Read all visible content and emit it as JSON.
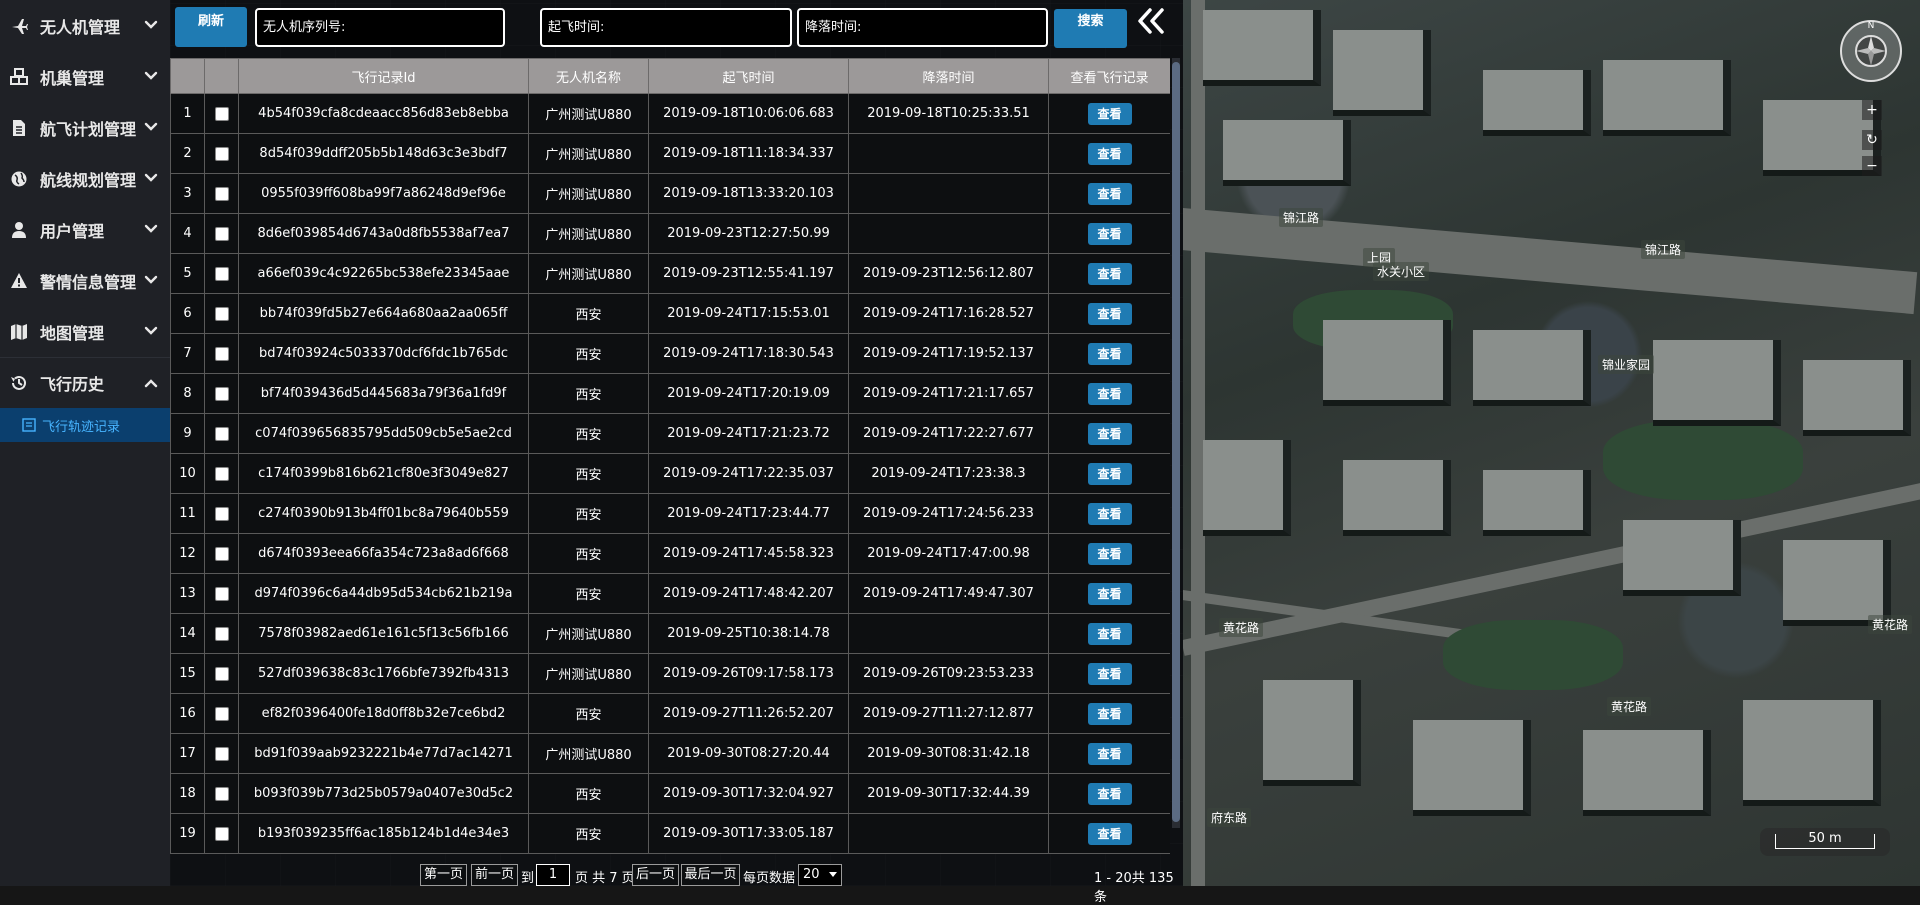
{
  "sidebar": {
    "items": [
      {
        "label": "无人机管理",
        "icon": "plane-icon",
        "open": false
      },
      {
        "label": "机巢管理",
        "icon": "cubes-icon",
        "open": false
      },
      {
        "label": "航飞计划管理",
        "icon": "file-icon",
        "open": false
      },
      {
        "label": "航线规划管理",
        "icon": "globe-icon",
        "open": false
      },
      {
        "label": "用户管理",
        "icon": "user-icon",
        "open": false
      },
      {
        "label": "警情信息管理",
        "icon": "warning-icon",
        "open": false
      },
      {
        "label": "地图管理",
        "icon": "map-icon",
        "open": false
      },
      {
        "label": "飞行历史",
        "icon": "history-icon",
        "open": true
      }
    ],
    "submenu": {
      "label": "飞行轨迹记录",
      "icon": "list-icon"
    }
  },
  "toolbar": {
    "refresh_label": "刷新",
    "serial_placeholder": "无人机序列号:",
    "takeoff_placeholder": "起飞时间:",
    "landing_placeholder": "降落时间:",
    "search_label": "搜索"
  },
  "table": {
    "columns": [
      "",
      "",
      "飞行记录Id",
      "无人机名称",
      "起飞时间",
      "降落时间",
      "查看飞行记录"
    ],
    "view_label": "查看",
    "rows": [
      {
        "num": "1",
        "id": "4b54f039cfa8cdeaacc856d83eb8ebba",
        "name": "广州测试U880",
        "takeoff": "2019-09-18T10:06:06.683",
        "landing": "2019-09-18T10:25:33.51"
      },
      {
        "num": "2",
        "id": "8d54f039ddff205b5b148d63c3e3bdf7",
        "name": "广州测试U880",
        "takeoff": "2019-09-18T11:18:34.337",
        "landing": ""
      },
      {
        "num": "3",
        "id": "0955f039ff608ba99f7a86248d9ef96e",
        "name": "广州测试U880",
        "takeoff": "2019-09-18T13:33:20.103",
        "landing": ""
      },
      {
        "num": "4",
        "id": "8d6ef039854d6743a0d8fb5538af7ea7",
        "name": "广州测试U880",
        "takeoff": "2019-09-23T12:27:50.99",
        "landing": ""
      },
      {
        "num": "5",
        "id": "a66ef039c4c92265bc538efe23345aae",
        "name": "广州测试U880",
        "takeoff": "2019-09-23T12:55:41.197",
        "landing": "2019-09-23T12:56:12.807"
      },
      {
        "num": "6",
        "id": "bb74f039fd5b27e664a680aa2aa065ff",
        "name": "西安",
        "takeoff": "2019-09-24T17:15:53.01",
        "landing": "2019-09-24T17:16:28.527"
      },
      {
        "num": "7",
        "id": "bd74f03924c5033370dcf6fdc1b765dc",
        "name": "西安",
        "takeoff": "2019-09-24T17:18:30.543",
        "landing": "2019-09-24T17:19:52.137"
      },
      {
        "num": "8",
        "id": "bf74f039436d5d445683a79f36a1fd9f",
        "name": "西安",
        "takeoff": "2019-09-24T17:20:19.09",
        "landing": "2019-09-24T17:21:17.657"
      },
      {
        "num": "9",
        "id": "c074f039656835795dd509cb5e5ae2cd",
        "name": "西安",
        "takeoff": "2019-09-24T17:21:23.72",
        "landing": "2019-09-24T17:22:27.677"
      },
      {
        "num": "10",
        "id": "c174f0399b816b621cf80e3f3049e827",
        "name": "西安",
        "takeoff": "2019-09-24T17:22:35.037",
        "landing": "2019-09-24T17:23:38.3"
      },
      {
        "num": "11",
        "id": "c274f0390b913b4ff01bc8a79640b559",
        "name": "西安",
        "takeoff": "2019-09-24T17:23:44.77",
        "landing": "2019-09-24T17:24:56.233"
      },
      {
        "num": "12",
        "id": "d674f0393eea66fa354c723a8ad6f668",
        "name": "西安",
        "takeoff": "2019-09-24T17:45:58.323",
        "landing": "2019-09-24T17:47:00.98"
      },
      {
        "num": "13",
        "id": "d974f0396c6a44db95d534cb621b219a",
        "name": "西安",
        "takeoff": "2019-09-24T17:48:42.207",
        "landing": "2019-09-24T17:49:47.307"
      },
      {
        "num": "14",
        "id": "7578f03982aed61e161c5f13c56fb166",
        "name": "广州测试U880",
        "takeoff": "2019-09-25T10:38:14.78",
        "landing": ""
      },
      {
        "num": "15",
        "id": "527df039638c83c1766bfe7392fb4313",
        "name": "广州测试U880",
        "takeoff": "2019-09-26T09:17:58.173",
        "landing": "2019-09-26T09:23:53.233"
      },
      {
        "num": "16",
        "id": "ef82f0396400fe18d0ff8b32e7ce6bd2",
        "name": "西安",
        "takeoff": "2019-09-27T11:26:52.207",
        "landing": "2019-09-27T11:27:12.877"
      },
      {
        "num": "17",
        "id": "bd91f039aab9232221b4e77d7ac14271",
        "name": "广州测试U880",
        "takeoff": "2019-09-30T08:27:20.44",
        "landing": "2019-09-30T08:31:42.18"
      },
      {
        "num": "18",
        "id": "b093f039b773d25b0579a0407e30d5c2",
        "name": "西安",
        "takeoff": "2019-09-30T17:32:04.927",
        "landing": "2019-09-30T17:32:44.39"
      },
      {
        "num": "19",
        "id": "b193f039235ff6ac185b124b1d4e34e3",
        "name": "西安",
        "takeoff": "2019-09-30T17:33:05.187",
        "landing": ""
      }
    ]
  },
  "pagination": {
    "first": "第一页",
    "prev": "前一页",
    "to": "到",
    "page": "1",
    "total_pages": "页 共 7 页",
    "next": "后一页",
    "last": "最后一页",
    "per_page_label": "每页数据",
    "page_size": "20",
    "range": "1 - 20共 135 条"
  },
  "map": {
    "labels": [
      "锦江路",
      "锦江路",
      "上园",
      "水关小区",
      "锦业家园",
      "黄花路",
      "黄花路",
      "黄花路",
      "府东路"
    ],
    "scale": "50 m",
    "controls": [
      "+",
      "↻",
      "−"
    ],
    "compass_n": "N"
  },
  "colors": {
    "accent": "#1f7bb3",
    "submenu_bg": "#0b3f6e",
    "submenu_text": "#47b4ff",
    "header_bg": "#9c9999"
  }
}
